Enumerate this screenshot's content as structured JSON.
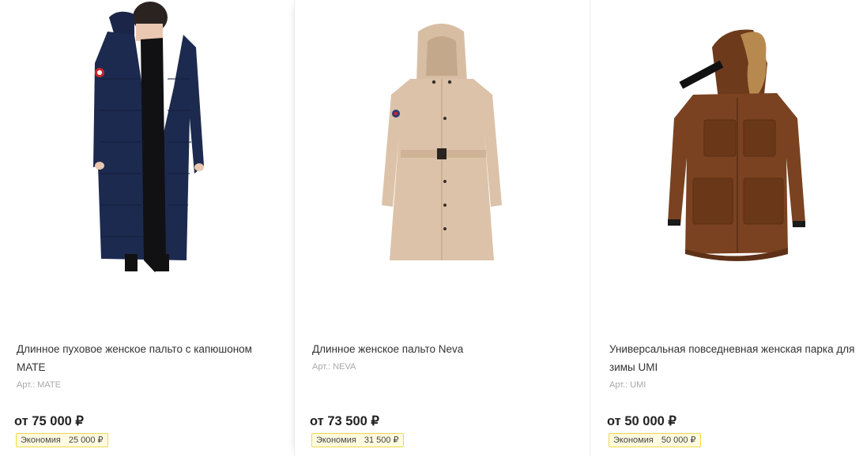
{
  "products": [
    {
      "title": "Длинное пуховое женское пальто с капюшоном MATE",
      "sku": "Арт.: MATE",
      "price": "от 75 000 ₽",
      "savings_label": "Экономия",
      "savings_value": "25 000 ₽",
      "image": "navy-long-down-coat-on-model"
    },
    {
      "title": "Длинное женское пальто Neva",
      "sku": "Арт.: NEVA",
      "price": "от 73 500 ₽",
      "savings_label": "Экономия",
      "savings_value": "31 500 ₽",
      "image": "beige-belted-hooded-coat"
    },
    {
      "title": "Универсальная повседневная женская парка для зимы UMI",
      "sku": "Арт.: UMI",
      "price": "от 50 000 ₽",
      "savings_label": "Экономия",
      "savings_value": "50 000 ₽",
      "image": "brown-parka-fur-hood"
    }
  ],
  "colors": {
    "savings_border": "#f2d84a",
    "savings_bg": "#fffbe0",
    "navy": "#1d2a4f",
    "beige": "#dcc2a8",
    "brown": "#7a4220"
  }
}
